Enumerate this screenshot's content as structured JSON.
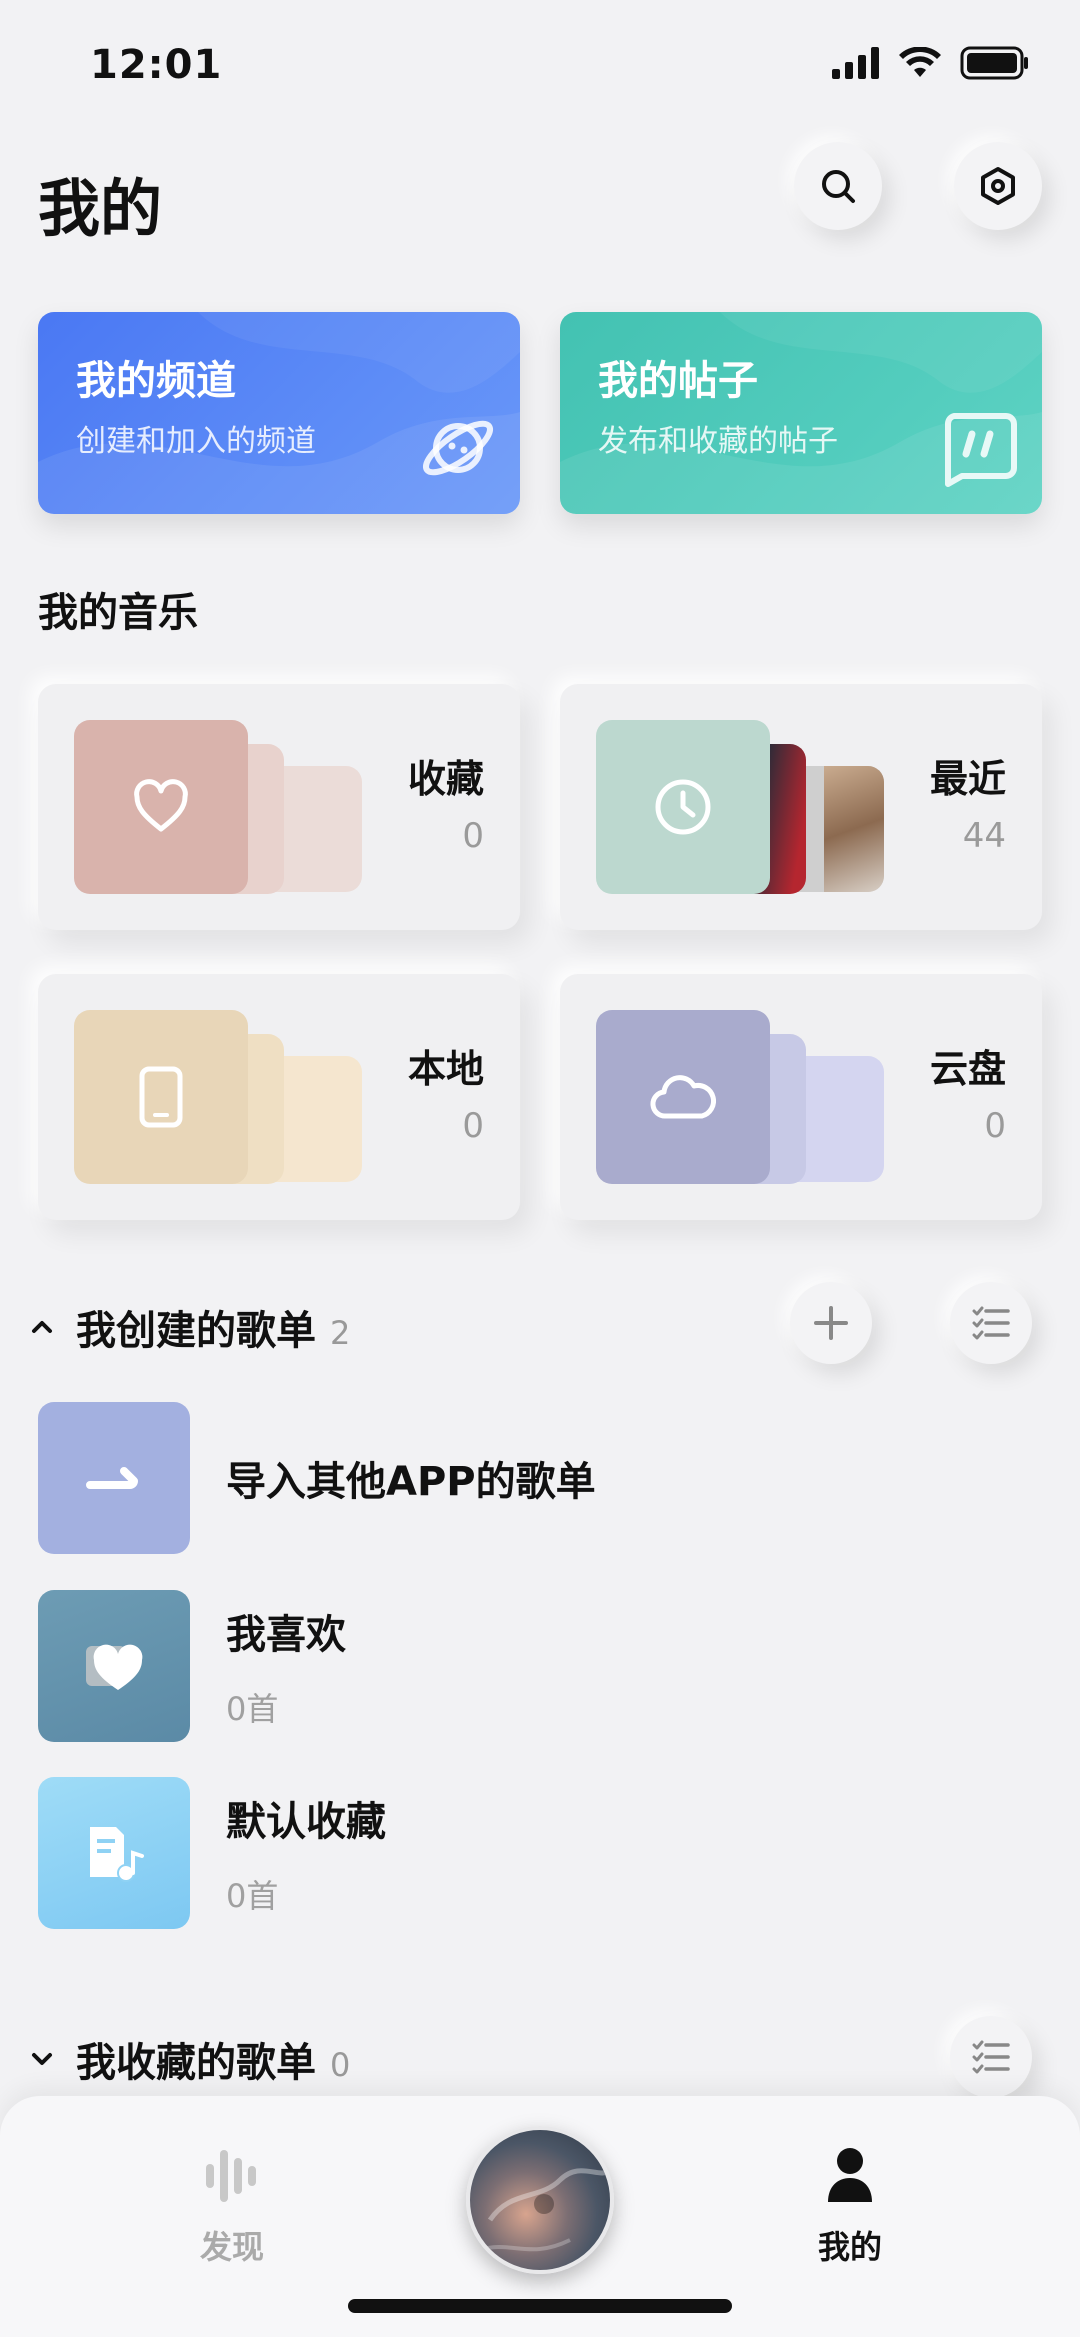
{
  "status": {
    "time": "12:01"
  },
  "header": {
    "title": "我的"
  },
  "cards": {
    "channel": {
      "title": "我的频道",
      "subtitle": "创建和加入的频道"
    },
    "posts": {
      "title": "我的帖子",
      "subtitle": "发布和收藏的帖子"
    }
  },
  "music": {
    "section_title": "我的音乐",
    "tiles": [
      {
        "label": "收藏",
        "count": "0"
      },
      {
        "label": "最近",
        "count": "44"
      },
      {
        "label": "本地",
        "count": "0"
      },
      {
        "label": "云盘",
        "count": "0"
      }
    ]
  },
  "created_playlists": {
    "title": "我创建的歌单",
    "count": "2",
    "items": [
      {
        "name": "导入其他APP的歌单"
      },
      {
        "name": "我喜欢",
        "sub": "0首"
      },
      {
        "name": "默认收藏",
        "sub": "0首"
      }
    ]
  },
  "collected_playlists": {
    "title": "我收藏的歌单",
    "count": "0"
  },
  "bottom_nav": {
    "discover": "发现",
    "mine": "我的"
  },
  "colors": {
    "channel_card": "#4f7df5",
    "posts_card": "#4cc8b7",
    "fav_tile": "#d9b3ac",
    "recent_tile": "#bcd8cf",
    "local_tile": "#e8d6b8",
    "cloud_tile": "#a9abcd"
  }
}
